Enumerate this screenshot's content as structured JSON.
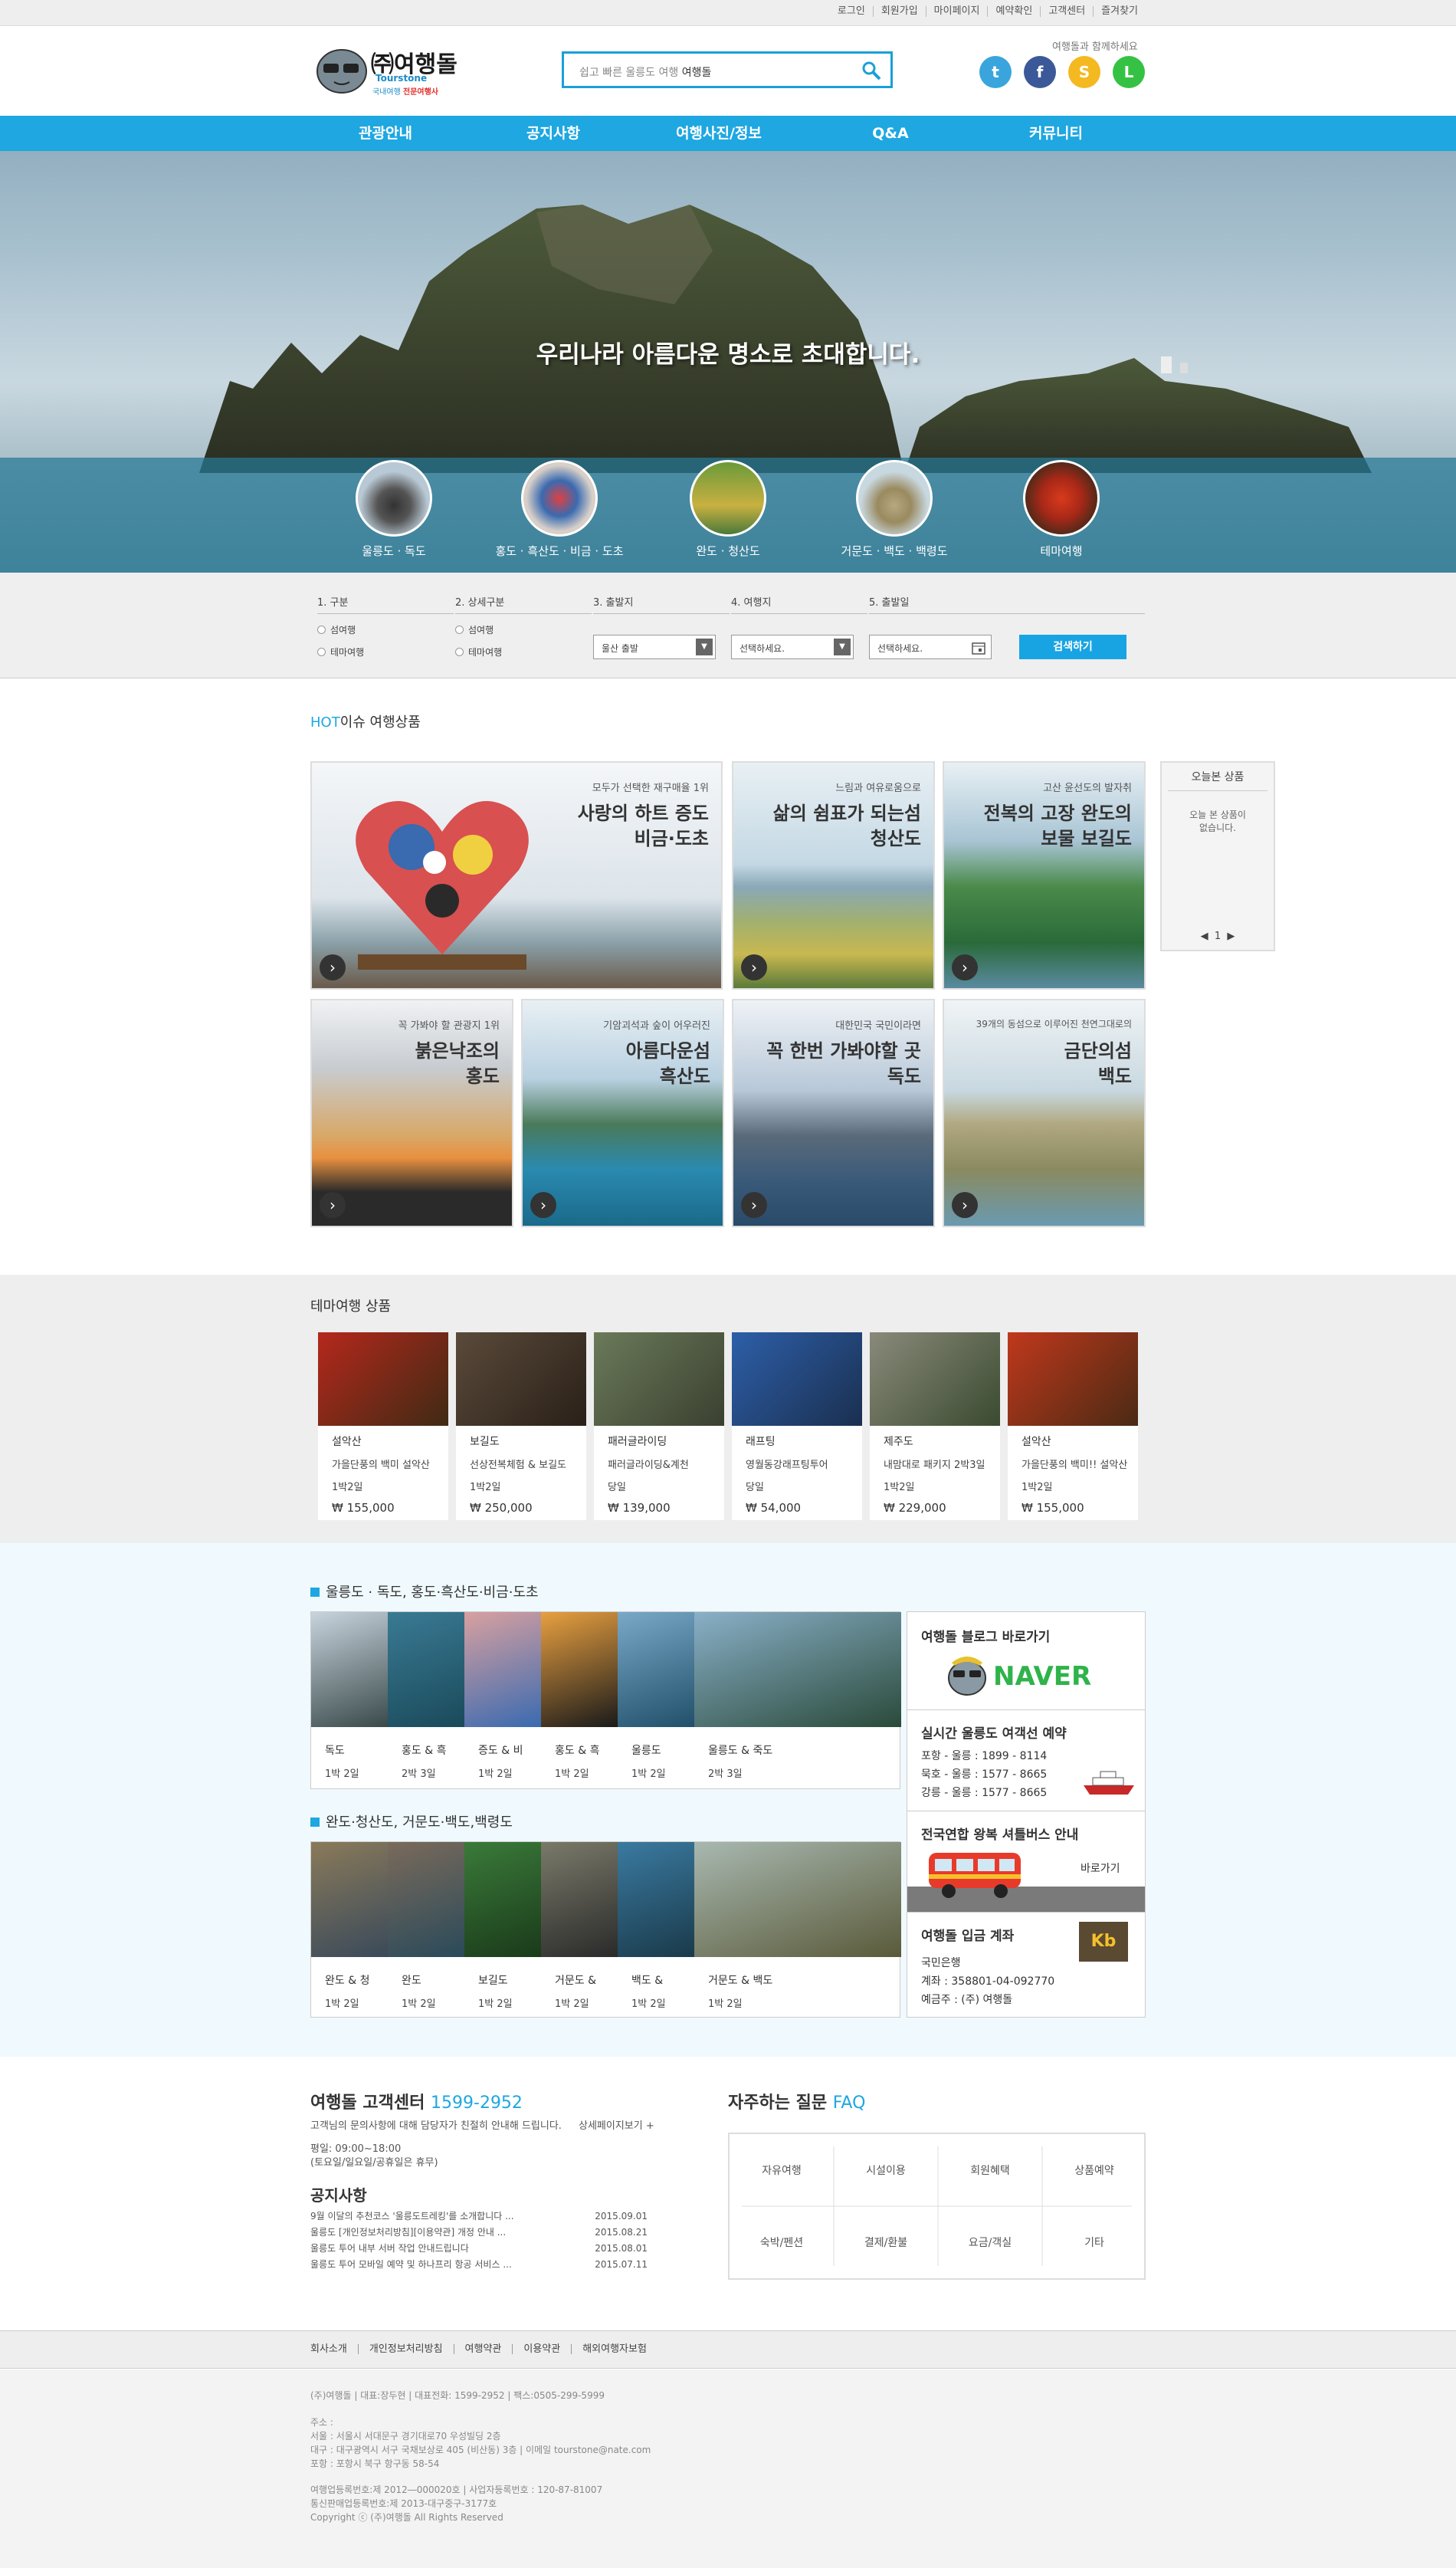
{
  "topbar": {
    "links": [
      "로그인",
      "회원가입",
      "마이페이지",
      "예약확인",
      "고객센터",
      "즐겨찾기"
    ]
  },
  "header": {
    "logo_main": "㈜여행돌",
    "logo_en": "Tourstone",
    "logo_sub1": "국내여행",
    "logo_sub2": "전문여행사",
    "search_prefix": "쉽고 빠른 울릉도 여행",
    "search_brand": "여행돌",
    "sns_label": "여행돌과 함께하세요",
    "sns": [
      {
        "name": "twitter",
        "glyph": "t",
        "color": "#3aa5dc"
      },
      {
        "name": "facebook",
        "glyph": "f",
        "color": "#3b5998"
      },
      {
        "name": "kakaostory",
        "glyph": "S",
        "color": "#f4b921"
      },
      {
        "name": "line",
        "glyph": "L",
        "color": "#35c244"
      }
    ]
  },
  "nav": [
    "관광안내",
    "공지사항",
    "여행사진/정보",
    "Q&A",
    "커뮤니티"
  ],
  "hero": {
    "title": "우리나라 아름다운 명소로 초대합니다.",
    "destinations": [
      "울릉도 · 독도",
      "홍도 · 흑산도 · 비금 · 도초",
      "완도 · 청산도",
      "거문도 · 백도 · 백령도",
      "테마여행"
    ]
  },
  "searchform": {
    "cols": [
      {
        "head": "1. 구분",
        "opts": [
          "섬여행",
          "테마여행"
        ]
      },
      {
        "head": "2. 상세구분",
        "opts": [
          "섬여행",
          "테마여행"
        ]
      },
      {
        "head": "3. 출발지",
        "select": "울산 출발"
      },
      {
        "head": "4. 여행지",
        "select": "선택하세요."
      },
      {
        "head": "5. 출발일",
        "select": "선택하세요."
      }
    ],
    "button": "검색하기"
  },
  "hot": {
    "title_hot": "HOT",
    "title_rest": "이슈 여행상품",
    "cards": [
      {
        "sub": "모두가 선택한 재구매율 1위",
        "title1": "사랑의 하트 증도",
        "title2": "비금·도초"
      },
      {
        "sub": "느림과 여유로움으로",
        "title1": "삶의 쉼표가 되는섬",
        "title2": "청산도"
      },
      {
        "sub": "고산 윤선도의 발자취",
        "title1": "전복의 고장 완도의",
        "title2": "보물 보길도"
      },
      {
        "sub": "꼭 가봐야 할 관광지 1위",
        "title1": "붉은낙조의",
        "title2": "홍도"
      },
      {
        "sub": "기암괴석과 숲이 어우러진",
        "title1": "아름다운섬",
        "title2": "흑산도"
      },
      {
        "sub": "대한민국 국민이라면",
        "title1": "꼭 한번 가봐야할 곳",
        "title2": "독도"
      },
      {
        "sub": "39개의 동섬으로 이루어진 천연그대로의",
        "title1": "금단의섬",
        "title2": "백도"
      }
    ],
    "recent_title": "오늘본 상품",
    "recent_empty1": "오늘 본 상품이",
    "recent_empty2": "없습니다.",
    "recent_page": "1"
  },
  "theme": {
    "title": "테마여행 상품",
    "items": [
      {
        "place": "설악산",
        "name": "가을단풍의 백미 설악산",
        "dur": "1박2일",
        "price": "₩ 155,000",
        "c1": "#b5281c",
        "c2": "#3f2a14"
      },
      {
        "place": "보길도",
        "name": "선상전복체험 & 보길도",
        "dur": "1박2일",
        "price": "₩ 250,000",
        "c1": "#5a4a3a",
        "c2": "#2a2018"
      },
      {
        "place": "패러글라이딩",
        "name": "패러글라이딩&계천",
        "dur": "당일",
        "price": "₩ 139,000",
        "c1": "#6b7a5a",
        "c2": "#3a4030"
      },
      {
        "place": "래프팅",
        "name": "영월동강래프팅투어",
        "dur": "당일",
        "price": "₩ 54,000",
        "c1": "#2d5fa8",
        "c2": "#1a2f50"
      },
      {
        "place": "제주도",
        "name": "내맘대로 패키지 2박3일",
        "dur": "1박2일",
        "price": "₩ 229,000",
        "c1": "#8a8a7a",
        "c2": "#3a4a30"
      },
      {
        "place": "설악산",
        "name": "가을단풍의 백미!! 설악산",
        "dur": "1박2일",
        "price": "₩ 155,000",
        "c1": "#c0381c",
        "c2": "#4a2a14"
      }
    ]
  },
  "region1": {
    "title": "울릉도 · 독도,  홍도·흑산도·비금·도초",
    "items": [
      {
        "name": "독도",
        "dur": "1박 2일",
        "c1": "#c8d4de",
        "c2": "#3a4a4a"
      },
      {
        "name": "홍도 & 흑",
        "dur": "2박 3일",
        "c1": "#3a7a94",
        "c2": "#1a4a5a"
      },
      {
        "name": "증도 & 비",
        "dur": "1박 2일",
        "c1": "#d8a0a0",
        "c2": "#3a6ab0"
      },
      {
        "name": "홍도 & 흑",
        "dur": "1박 2일",
        "c1": "#e8a040",
        "c2": "#1a1a1a"
      },
      {
        "name": "울릉도",
        "dur": "1박 2일",
        "c1": "#7aa8c8",
        "c2": "#20506a"
      },
      {
        "name": "울릉도 & 죽도",
        "dur": "2박 3일",
        "c1": "#8ab0c8",
        "c2": "#2a4a3a"
      }
    ]
  },
  "region2": {
    "title": "완도·청산도,  거문도·백도,백령도",
    "items": [
      {
        "name": "완도 & 청",
        "dur": "1박 2일",
        "c1": "#8a7a5a",
        "c2": "#3a4a5a"
      },
      {
        "name": "완도",
        "dur": "1박 2일",
        "c1": "#7a6a5a",
        "c2": "#2a4a5a"
      },
      {
        "name": "보길도",
        "dur": "1박 2일",
        "c1": "#3a7a3a",
        "c2": "#1a3a1a"
      },
      {
        "name": "거문도 &",
        "dur": "1박 2일",
        "c1": "#7a7a6a",
        "c2": "#2a2a2a"
      },
      {
        "name": "백도 &",
        "dur": "1박 2일",
        "c1": "#3a7aa0",
        "c2": "#1a3a4a"
      },
      {
        "name": "거문도 & 백도",
        "dur": "1박 2일",
        "c1": "#a8b8b0",
        "c2": "#5a5a3a"
      }
    ]
  },
  "side": {
    "blog_title": "여행돌 블로그 바로가기",
    "naver": "NAVER",
    "ferry_title": "실시간 울릉도 여객선 예약",
    "ferry": [
      "포항 - 울릉 : 1899 - 8114",
      "묵호 - 울릉 : 1577 - 8665",
      "강릉 - 울릉 : 1577 - 8665"
    ],
    "bus_title": "전국연합 왕복 셔틀버스 안내",
    "bus_link": "바로가기",
    "bank_title": "여행돌 입금 계좌",
    "bank_logo": "Kb",
    "bank": [
      "국민은행",
      "계좌 : 358801-04-092770",
      "예금주 : (주) 여행돌"
    ]
  },
  "cs": {
    "title": "여행돌 고객센터",
    "phone": "1599-2952",
    "desc": "고객님의 문의사항에 대해 담당자가 친절히 안내해 드립니다.",
    "more": "상세페이지보기 +",
    "hours1": "평일: 09:00~18:00",
    "hours2": "(토요일/일요일/공휴일은 휴무)",
    "notice_title": "공지사항",
    "notices": [
      {
        "t": "9월 이달의 추천코스 '울릉도트레킹'를 소개합니다 ...",
        "d": "2015.09.01"
      },
      {
        "t": "울릉도 [개인정보처리방침][이용약관] 개정 안내 ...",
        "d": "2015.08.21"
      },
      {
        "t": "울릉도 투어 내부 서버 작업 안내드립니다",
        "d": "2015.08.01"
      },
      {
        "t": "울릉도 투어 모바일 예약 및 하나프리 항공 서비스 ...",
        "d": "2015.07.11"
      }
    ]
  },
  "faq": {
    "title": "자주하는 질문",
    "title_en": "FAQ",
    "items": [
      "자유여행",
      "시설이용",
      "회원혜택",
      "상품예약",
      "숙박/펜션",
      "결제/환불",
      "요금/객실",
      "기타"
    ]
  },
  "footer": {
    "links": [
      "회사소개",
      "개인정보처리방침",
      "여행약관",
      "이용약관",
      "해외여행자보험"
    ],
    "line1": "(주)여행돌  |  대표:장두현  |  대표전화: 1599-2952  |  팩스:0505-299-5999",
    "addr_title": "주소 :",
    "addr1": "서울 : 서울시 서대문구 경기대로70 우성빌딩 2층",
    "addr2": "대구 : 대구광역시 서구 국채보상로 405 (비산동) 3층  |  이메일 tourstone@nate.com",
    "addr3": "포항 : 포항시 북구 항구동 58-54",
    "reg1": "여행업등록번호:제 2012―000020호  |  사업자등록번호 : 120-87-81007",
    "reg2": "통신판매업등록번호:제 2013-대구중구-3177호",
    "copy": "Copyright ⓒ (주)여행돌 All Rights Reserved"
  }
}
